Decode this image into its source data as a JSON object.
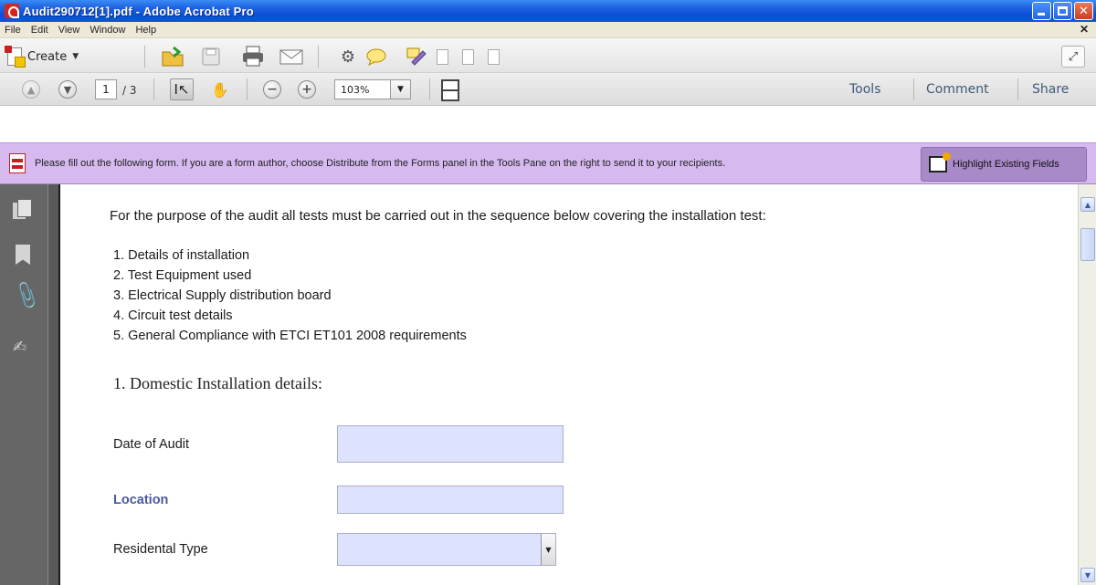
{
  "window": {
    "title": "Audit290712[1].pdf - Adobe Acrobat Pro"
  },
  "menu": {
    "items": [
      "File",
      "Edit",
      "View",
      "Window",
      "Help"
    ]
  },
  "toolbar": {
    "create_label": "Create",
    "page_current": "1",
    "page_total": "/ 3",
    "zoom": "103%"
  },
  "panes": {
    "tools": "Tools",
    "comment": "Comment",
    "share": "Share"
  },
  "notice": {
    "text": "Please fill out the following form. If you are a form author, choose Distribute from the Forms panel in the Tools Pane on the right to send it to your recipients.",
    "highlight_button": "Highlight Existing Fields"
  },
  "document": {
    "intro": "For the purpose of the audit all tests must be carried out in the sequence below covering the installation test:",
    "list": [
      "1. Details of installation",
      "2. Test Equipment used",
      "3. Electrical Supply distribution board",
      "4. Circuit test details",
      "5. General Compliance with ETCI ET101 2008 requirements"
    ],
    "section_heading": "1. Domestic Installation details:",
    "fields": {
      "date_label": "Date of Audit",
      "date_value": "",
      "location_label": "Location",
      "location_value": "",
      "residential_label": "Residental Type",
      "residential_value": ""
    }
  },
  "colors": {
    "titlebar": "#0a4fd6",
    "notice_bg": "#d6b9ef",
    "field_bg": "#dde2ff",
    "location_label": "#4a5a9a"
  }
}
